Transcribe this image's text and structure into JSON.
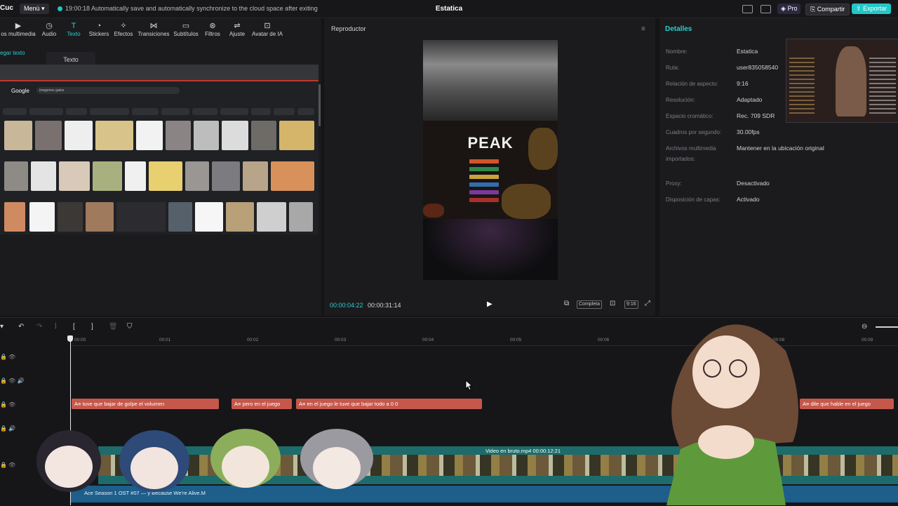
{
  "topbar": {
    "app_logo": "Cuc",
    "menu_label": "Menú",
    "autosave_text": "19:00:18 Automatically save and automatically synchronize to the cloud space after exiting",
    "project_title": "Estatica",
    "pro_label": "Pro",
    "share_label": "Compartir",
    "export_label": "Exportar"
  },
  "toolbar": {
    "items": [
      {
        "label": "os multimedia",
        "icon": "media-icon"
      },
      {
        "label": "Audio",
        "icon": "audio-icon"
      },
      {
        "label": "Texto",
        "icon": "text-icon"
      },
      {
        "label": "Stickers",
        "icon": "sticker-icon"
      },
      {
        "label": "Efectos",
        "icon": "effects-icon"
      },
      {
        "label": "Transiciones",
        "icon": "transition-icon"
      },
      {
        "label": "Subtítulos",
        "icon": "subtitles-icon"
      },
      {
        "label": "Filtros",
        "icon": "filter-icon"
      },
      {
        "label": "Ajuste",
        "icon": "adjust-icon"
      },
      {
        "label": "Avatar de IA",
        "icon": "ai-avatar-icon"
      }
    ],
    "active": "Texto"
  },
  "left": {
    "add_text_label": "egar texto",
    "subtab_label": "Texto",
    "preview": {
      "google_label": "Google",
      "search_text": "imagenes gatos"
    }
  },
  "player": {
    "title": "Reproductor",
    "video_logo": "PEAK",
    "time_current": "00:00:04:22",
    "time_total": "00:00:31:14",
    "fit_label": "Completa",
    "ratio_label": "9:16"
  },
  "details": {
    "title": "Detalles",
    "rows": [
      {
        "label": "Nombre:",
        "value": "Estatica"
      },
      {
        "label": "Ruta:",
        "value": "user835058540"
      },
      {
        "label": "Relación de aspecto:",
        "value": "9:16"
      },
      {
        "label": "Resolución:",
        "value": "Adaptado"
      },
      {
        "label": "Espacio cromático:",
        "value": "Rec. 709 SDR"
      },
      {
        "label": "Cuadros por segundo:",
        "value": "30.00fps"
      },
      {
        "label": "Archivos multimedia",
        "label2": "importados:",
        "value": "Mantener en la ubicación original"
      },
      {
        "label": "Proxy:",
        "value": "Desactivado"
      },
      {
        "label": "Disposición de capas:",
        "value": "Activado"
      }
    ]
  },
  "timeline": {
    "ruler": [
      "00:00",
      "00:01",
      "00:02",
      "00:03",
      "00:04",
      "00:05",
      "00:06",
      "00:08",
      "00:09"
    ],
    "text_clips": [
      {
        "label": "A≡ tuve que bajar de golpe el volumen"
      },
      {
        "label": "A≡ pero en el juego"
      },
      {
        "label": "A≡ en el juego le tuve que bajar todo a 0 0"
      },
      {
        "label": "A≡ dile que hable en el juego"
      }
    ],
    "video_clip_label": "Video en bruto.mp4  00:00:12:21",
    "audio_clip_label": "Ace Season 1 OST #07 — y Because We're Alive.M"
  },
  "colors": {
    "accent": "#26d0d0",
    "text_clip": "#c6574b",
    "video_track": "#1e6b6b",
    "audio_track": "#1d5e8a"
  }
}
